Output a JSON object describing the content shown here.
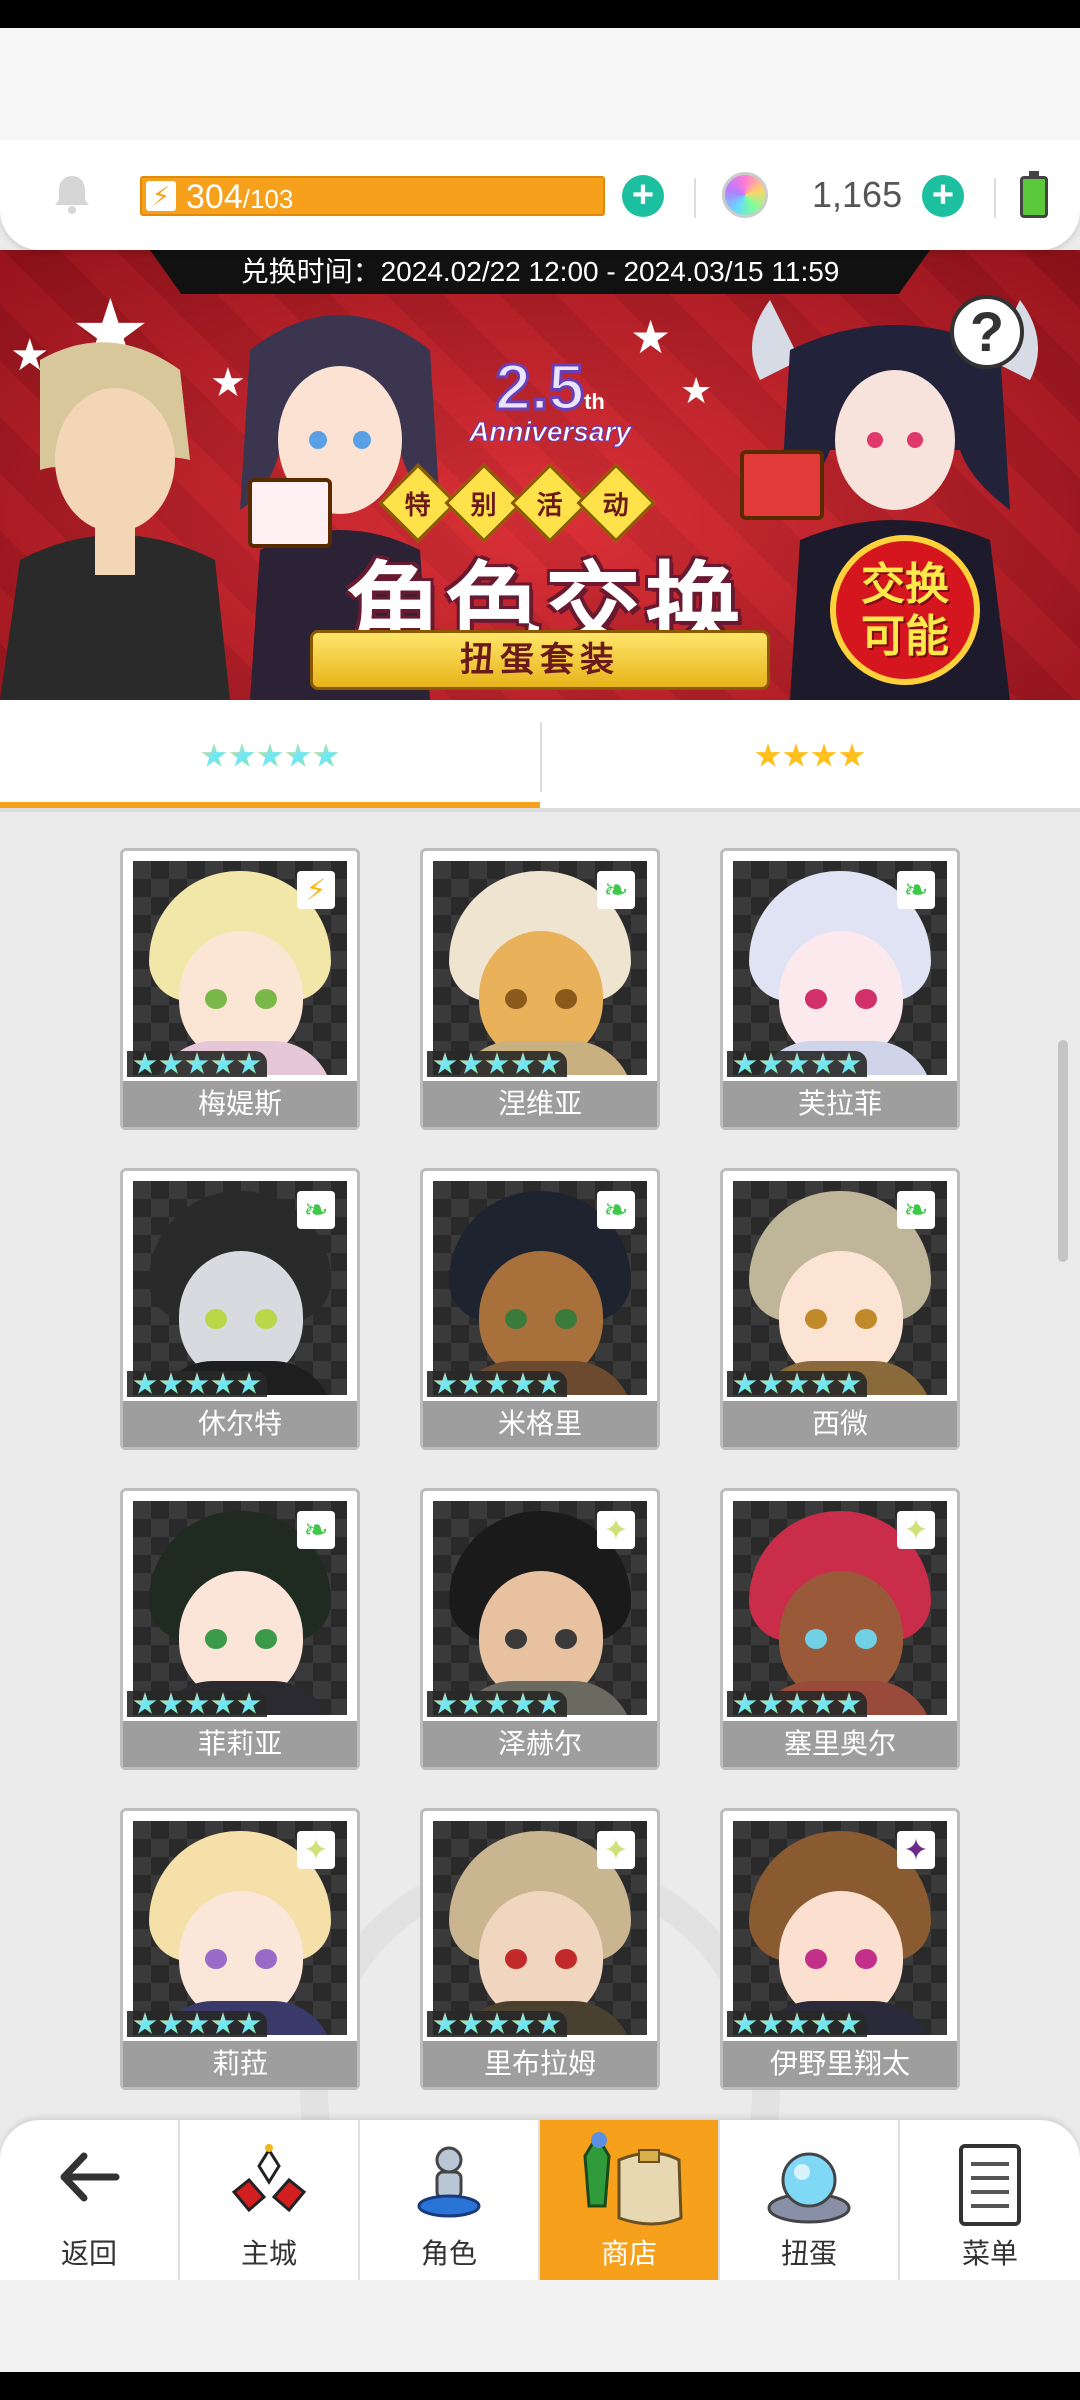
{
  "header": {
    "stamina_current": "304",
    "stamina_max": "/103",
    "gem_count": "1,165"
  },
  "banner": {
    "exchange_time": "兑换时间：2024.02/22 12:00 - 2024.03/15 11:59",
    "anniversary_number": "2.5",
    "anniversary_suffix": "th",
    "anniversary_word": "Anniversary",
    "special_chars": [
      "特",
      "别",
      "活",
      "动"
    ],
    "title": "角色交换",
    "ribbon": "扭蛋套装",
    "badge_line1": "交换",
    "badge_line2": "可能",
    "help": "?"
  },
  "tabs": [
    {
      "label": "5-star",
      "stars": 5,
      "style": "rainbow",
      "active": true
    },
    {
      "label": "4-star",
      "stars": 4,
      "style": "gold",
      "active": false
    }
  ],
  "characters": [
    {
      "name": "梅媞斯",
      "attribute": "lightning",
      "rarity": 5
    },
    {
      "name": "涅维亚",
      "attribute": "wind",
      "rarity": 5
    },
    {
      "name": "芙拉菲",
      "attribute": "wind",
      "rarity": 5
    },
    {
      "name": "休尔特",
      "attribute": "wind",
      "rarity": 5
    },
    {
      "name": "米格里",
      "attribute": "wind",
      "rarity": 5
    },
    {
      "name": "西微",
      "attribute": "wind",
      "rarity": 5
    },
    {
      "name": "菲莉亚",
      "attribute": "wind",
      "rarity": 5
    },
    {
      "name": "泽赫尔",
      "attribute": "light",
      "rarity": 5
    },
    {
      "name": "塞里奥尔",
      "attribute": "light",
      "rarity": 5
    },
    {
      "name": "莉菈",
      "attribute": "light",
      "rarity": 5
    },
    {
      "name": "里布拉姆",
      "attribute": "light",
      "rarity": 5
    },
    {
      "name": "伊野里翔太",
      "attribute": "shadow",
      "rarity": 5
    }
  ],
  "nav": {
    "back": "返回",
    "home": "主城",
    "characters": "角色",
    "shop": "商店",
    "gacha": "扭蛋",
    "menu": "菜单"
  },
  "colors": {
    "accent": "#f6a01c",
    "plus": "#1cbf9f",
    "banner_red": "#c81a25",
    "name_bar": "#9e9e9e"
  }
}
